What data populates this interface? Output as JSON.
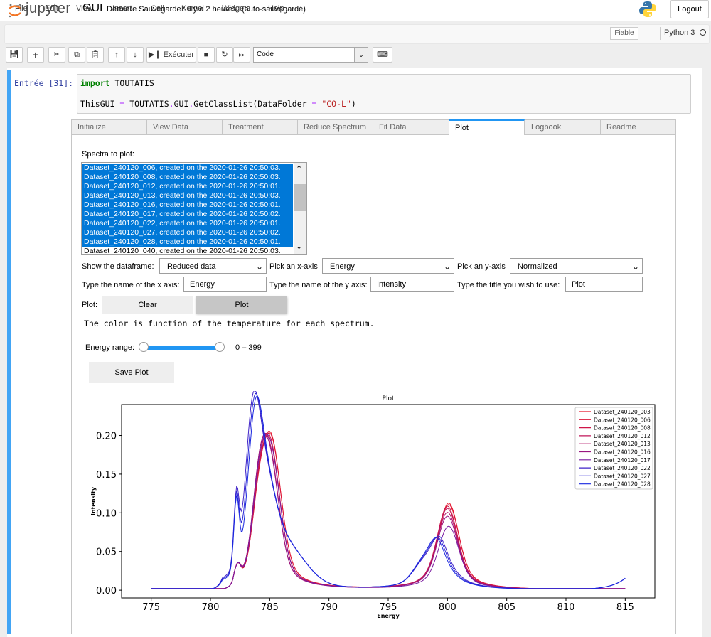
{
  "header": {
    "logo_text": "jupyter",
    "notebook_name": "GUI",
    "checkpoint": "Dernière Sauvegarde : il y a 2 heures",
    "autosave": "(auto-sauvegardé)",
    "logout": "Logout"
  },
  "menu": [
    "File",
    "Edit",
    "View",
    "Insert",
    "Cell",
    "Kernel",
    "Widgets",
    "Help"
  ],
  "trusted": "Fiable",
  "kernel": "Python 3",
  "toolbar": {
    "run_label": "Exécuter",
    "cell_type": "Code"
  },
  "cell": {
    "prompt": "Entrée [31]:",
    "code_kw": "import",
    "code_mod": " TOUTATIS",
    "code2_a": "ThisGUI ",
    "code2_eq": "=",
    "code2_b": " TOUTATIS",
    "code2_dot1": ".",
    "code2_c": "GUI",
    "code2_dot2": ".",
    "code2_d": "GetClassList(DataFolder ",
    "code2_eq2": "=",
    "code2_str": " \"CO-L\"",
    "code2_end": ")"
  },
  "tabs": [
    "Initialize",
    "View Data",
    "Treatment",
    "Reduce Spectrum",
    "Fit Data",
    "Plot",
    "Logbook",
    "Readme"
  ],
  "spectra": {
    "label": "Spectra to plot:",
    "items": [
      "Dataset_240120_006, created on the 2020-01-26 20:50:03.",
      "Dataset_240120_008, created on the 2020-01-26 20:50:03.",
      "Dataset_240120_012, created on the 2020-01-26 20:50:01.",
      "Dataset_240120_013, created on the 2020-01-26 20:50:03.",
      "Dataset_240120_016, created on the 2020-01-26 20:50:01.",
      "Dataset_240120_017, created on the 2020-01-26 20:50:02.",
      "Dataset_240120_022, created on the 2020-01-26 20:50:01.",
      "Dataset_240120_027, created on the 2020-01-26 20:50:02.",
      "Dataset_240120_028, created on the 2020-01-26 20:50:01.",
      "Dataset_240120_040, created on the 2020-01-26 20:50:03."
    ]
  },
  "controls": {
    "dataframe_label": "Show the dataframe:",
    "dataframe_value": "Reduced data",
    "xaxis_label": "Pick an x-axis",
    "xaxis_value": "Energy",
    "yaxis_label": "Pick an y-axis",
    "yaxis_value": "Normalized",
    "xname_label": "Type the name of the x axis:",
    "xname_value": "Energy",
    "yname_label": "Type the name of the y axis:",
    "yname_value": "Intensity",
    "title_label": "Type the title you wish to use:",
    "title_value": "Plot",
    "plot_label": "Plot:",
    "clear_button": "Clear",
    "plot_button": "Plot",
    "info_text": "The color is function of the temperature for each spectrum.",
    "energy_label": "Energy range:",
    "energy_value": "0 – 399",
    "save_button": "Save Plot"
  },
  "chart_data": {
    "type": "line",
    "title": "Plot",
    "xlabel": "Energy",
    "ylabel": "Intensity",
    "xlim": [
      772.5,
      817.5
    ],
    "ylim": [
      -0.01,
      0.24
    ],
    "xticks": [
      775,
      780,
      785,
      790,
      795,
      800,
      805,
      810,
      815
    ],
    "yticks": [
      0.0,
      0.05,
      0.1,
      0.15,
      0.2
    ],
    "grid": false,
    "legend": "top-right",
    "series": [
      {
        "name": "Dataset_240120_003",
        "color": "#e8182c",
        "profile": "late",
        "p1": 0.196,
        "p1x": 785.1,
        "shoulder": 0.12,
        "p2": 0.112,
        "p2x": 800.1
      },
      {
        "name": "Dataset_240120_006",
        "color": "#dc1738",
        "profile": "late",
        "p1": 0.194,
        "p1x": 785.1,
        "shoulder": 0.118,
        "p2": 0.11,
        "p2x": 800.1
      },
      {
        "name": "Dataset_240120_008",
        "color": "#cf1648",
        "profile": "late",
        "p1": 0.19,
        "p1x": 785.0,
        "shoulder": 0.115,
        "p2": 0.108,
        "p2x": 800.0
      },
      {
        "name": "Dataset_240120_012",
        "color": "#c01558",
        "profile": "late",
        "p1": 0.186,
        "p1x": 785.0,
        "shoulder": 0.112,
        "p2": 0.105,
        "p2x": 800.0
      },
      {
        "name": "Dataset_240120_013",
        "color": "#b01468",
        "profile": "late",
        "p1": 0.182,
        "p1x": 784.9,
        "shoulder": 0.125,
        "p2": 0.1,
        "p2x": 800.0
      },
      {
        "name": "Dataset_240120_016",
        "color": "#9a1680",
        "profile": "late",
        "p1": 0.178,
        "p1x": 784.9,
        "shoulder": 0.13,
        "p2": 0.095,
        "p2x": 800.0
      },
      {
        "name": "Dataset_240120_017",
        "color": "#7a1aa0",
        "profile": "mid",
        "p1": 0.185,
        "p1x": 785.0,
        "shoulder": 0.135,
        "p2": 0.082,
        "p2x": 800.1
      },
      {
        "name": "Dataset_240120_022",
        "color": "#3f22c8",
        "profile": "early",
        "p1": 0.23,
        "p1x": 783.5,
        "shoulder": 0.22,
        "p2": 0.07,
        "p2x": 799.3
      },
      {
        "name": "Dataset_240120_027",
        "color": "#2a25d6",
        "profile": "early",
        "p1": 0.222,
        "p1x": 783.6,
        "shoulder": 0.21,
        "p2": 0.068,
        "p2x": 799.2
      },
      {
        "name": "Dataset_240120_028",
        "color": "#1a28e0",
        "profile": "early",
        "p1": 0.214,
        "p1x": 783.7,
        "shoulder": 0.205,
        "p2": 0.066,
        "p2x": 799.1
      }
    ]
  }
}
